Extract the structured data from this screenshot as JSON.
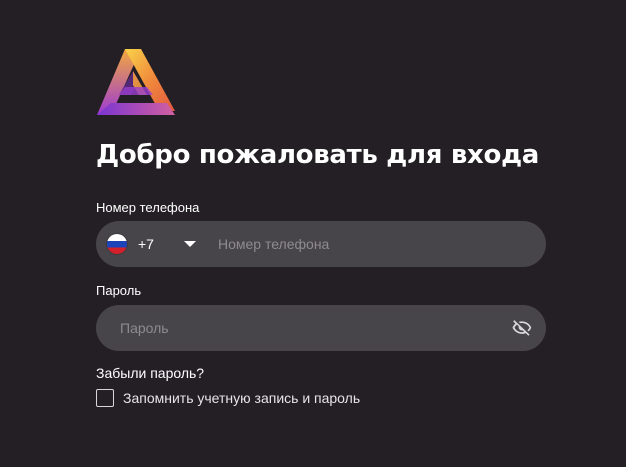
{
  "header": {
    "logo_icon": "triangle-logo-icon",
    "title": "Добро пожаловать для входа"
  },
  "form": {
    "phone": {
      "label": "Номер телефона",
      "country_flag_icon": "russia-flag-icon",
      "country_code": "+7",
      "dropdown_icon": "caret-down-icon",
      "placeholder": "Номер телефона",
      "value": ""
    },
    "password": {
      "label": "Пароль",
      "placeholder": "Пароль",
      "value": "",
      "visibility_icon": "eye-off-icon"
    },
    "forgot_password": "Забыли пароль?",
    "remember": {
      "label": "Запомнить учетную запись и пароль",
      "checked": false
    }
  },
  "colors": {
    "background": "#241f25",
    "field_background": "#48454a",
    "placeholder": "#8e8b8f",
    "logo_gradient": [
      "#f7c948",
      "#f08a3c",
      "#a23ed8"
    ]
  }
}
